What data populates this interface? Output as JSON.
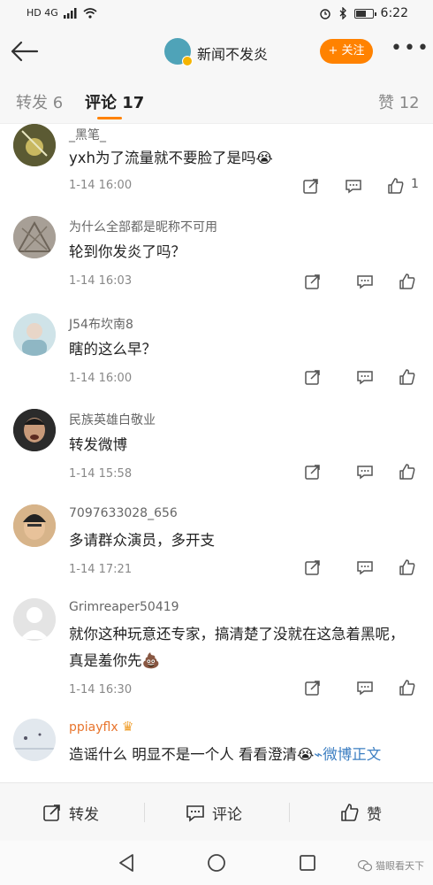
{
  "status_bar": {
    "network": "HD 4G",
    "time": "6:22"
  },
  "header": {
    "account_name": "新闻不发炎",
    "follow_label": "+ 关注"
  },
  "tabs": [
    {
      "label": "转发 6"
    },
    {
      "label": "评论 17"
    },
    {
      "label": "赞 12"
    }
  ],
  "comments": [
    {
      "user": "_黑笔_",
      "text": "yxh为了流量就不要脸了是吗😭",
      "time": "1-14 16:00",
      "likes": "1"
    },
    {
      "user": "为什么全部都是昵称不可用",
      "text": "轮到你发炎了吗？",
      "time": "1-14 16:03",
      "likes": ""
    },
    {
      "user": "J54布坎南8",
      "text": "瞎的这么早？",
      "time": "1-14 16:00",
      "likes": ""
    },
    {
      "user": "民族英雄白敬业",
      "text": "转发微博",
      "time": "1-14 15:58",
      "likes": ""
    },
    {
      "user": "7097633028_656",
      "text": "多请群众演员，多开支",
      "time": "1-14 17:21",
      "likes": ""
    },
    {
      "user": "Grimreaper50419",
      "text": "就你这种玩意还专家，搞清楚了没就在这急着黑呢，真是羞你先💩",
      "time": "1-14 16:30",
      "likes": ""
    },
    {
      "user": "ppiayflx",
      "text": "造谣什么 明显不是一个人 看看澄清😭",
      "link_text": "微博正文",
      "time": "",
      "likes": ""
    }
  ],
  "bottom_bar": {
    "repost": "转发",
    "comment": "评论",
    "like": "赞"
  },
  "watermark": "猫眼看天下",
  "colors": {
    "accent": "#ff8200",
    "link": "#3d7fc2",
    "vip_name": "#e8742c"
  }
}
